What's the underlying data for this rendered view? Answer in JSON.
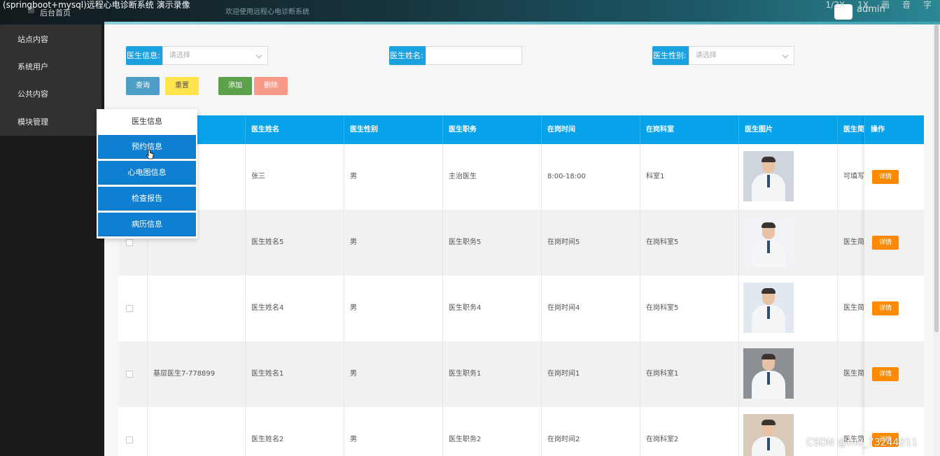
{
  "video": {
    "title": "(springboot+mysql)远程心电诊断系统 演示录像",
    "controls": [
      "1/2X",
      "1X",
      "画",
      "音",
      "字"
    ]
  },
  "header": {
    "welcome": "欢迎使用远程心电诊断系统",
    "user": "admin"
  },
  "sidebar": {
    "home": "后台首页",
    "items": [
      {
        "label": "站点内容"
      },
      {
        "label": "系统用户"
      },
      {
        "label": "公共内容"
      },
      {
        "label": "模块管理"
      }
    ]
  },
  "search": {
    "doctor_info": {
      "label": "医生信息:",
      "placeholder": "请选择"
    },
    "doctor_name": {
      "label": "医生姓名:",
      "value": ""
    },
    "doctor_gender": {
      "label": "医生性别:",
      "placeholder": "请选择"
    }
  },
  "buttons": {
    "query": "查询",
    "reset": "重置",
    "add": "添加",
    "delete": "删除"
  },
  "table": {
    "headers": [
      "医生姓名",
      "医生性别",
      "医生职务",
      "在岗时间",
      "在岗科室",
      "医生图片",
      "医生简介",
      "操作"
    ],
    "detail_label": "详情",
    "rows": [
      {
        "info": "",
        "name": "张三",
        "gender": "男",
        "title": "主治医生",
        "time": "8:00-18:00",
        "dept": "科室1",
        "intro": "可填写"
      },
      {
        "info": "",
        "name": "医生姓名5",
        "gender": "男",
        "title": "医生职务5",
        "time": "在岗时间5",
        "dept": "在岗科室5",
        "intro": "医生简"
      },
      {
        "info": "",
        "name": "医生姓名4",
        "gender": "男",
        "title": "医生职务4",
        "time": "在岗时间4",
        "dept": "在岗科室5",
        "intro": "医生简"
      },
      {
        "info": "基层医生7-778899",
        "name": "医生姓名1",
        "gender": "男",
        "title": "医生职务1",
        "time": "在岗时间1",
        "dept": "在岗科室1",
        "intro": "医生简"
      },
      {
        "info": "",
        "name": "医生姓名2",
        "gender": "男",
        "title": "医生职务2",
        "time": "在岗时间2",
        "dept": "在岗科室2",
        "intro": "医生简"
      }
    ]
  },
  "flyout": {
    "title": "医生信息",
    "items": [
      "预约信息",
      "心电图信息",
      "检查报告",
      "病历信息"
    ]
  },
  "watermark": "CSDN @m0_73244011",
  "colors": {
    "header_blue": "#06a2ea",
    "detail_orange": "#ff8a00",
    "menu_blue": "#0f7fd1"
  }
}
